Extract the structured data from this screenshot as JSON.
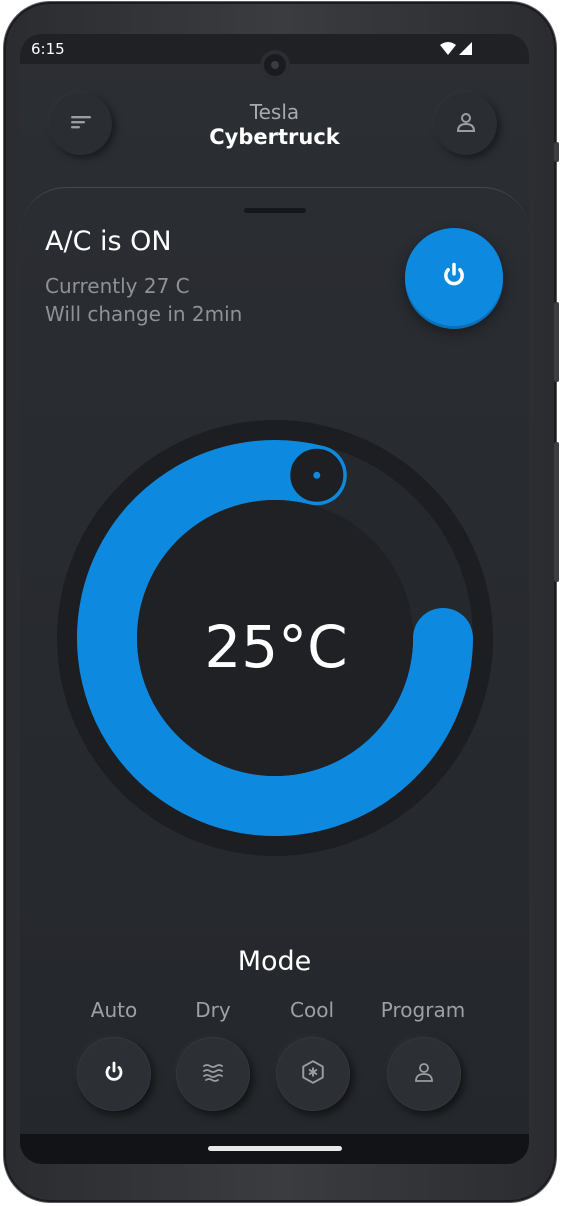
{
  "status_bar": {
    "time": "6:15"
  },
  "header": {
    "brand": "Tesla",
    "model": "Cybertruck",
    "menu_icon": "menu-icon",
    "profile_icon": "user-icon"
  },
  "ac": {
    "title": "A/C is ON",
    "current": "Currently 27 C",
    "change": "Will change in 2min",
    "power_icon": "power-icon"
  },
  "dial": {
    "temperature": "25°C",
    "level": 0.79,
    "accent": "#0d8ae0"
  },
  "mode": {
    "title": "Mode",
    "items": [
      {
        "label": "Auto",
        "icon": "power-icon"
      },
      {
        "label": "Dry",
        "icon": "wind-icon"
      },
      {
        "label": "Cool",
        "icon": "snowflake-hexagon-icon"
      },
      {
        "label": "Program",
        "icon": "user-icon"
      }
    ]
  }
}
